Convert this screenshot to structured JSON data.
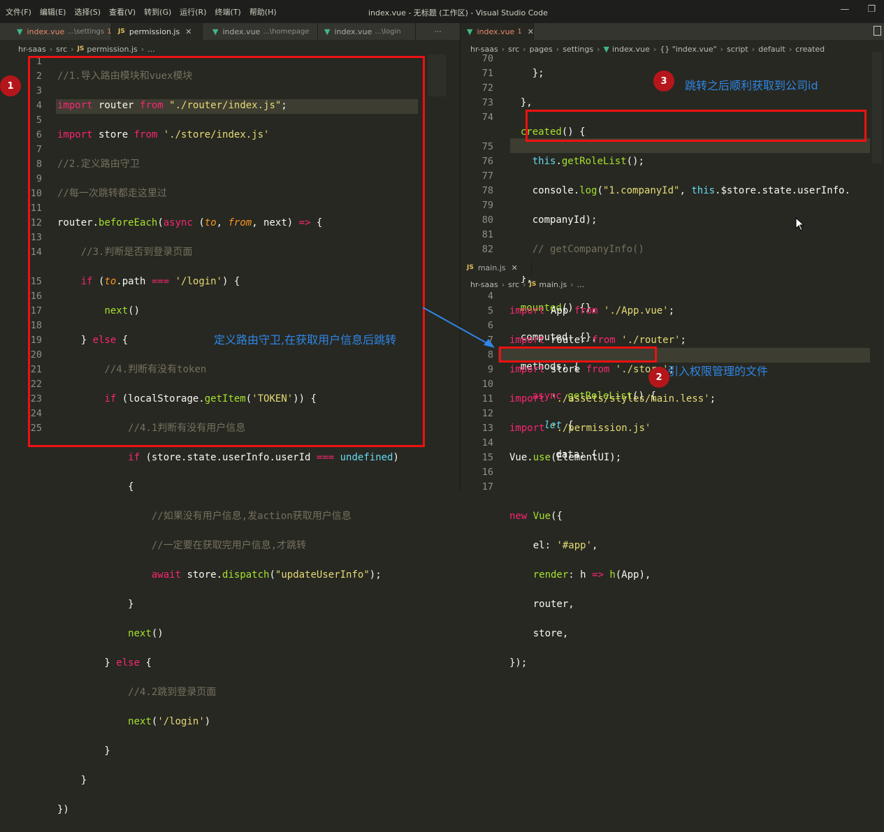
{
  "menu": [
    "文件(F)",
    "编辑(E)",
    "选择(S)",
    "查看(V)",
    "转到(G)",
    "运行(R)",
    "终端(T)",
    "帮助(H)"
  ],
  "window_title": "index.vue - 无标题 (工作区) - Visual Studio Code",
  "window_controls": [
    "—",
    "❐"
  ],
  "left_tabs": [
    {
      "name": "index.vue",
      "desc": "...\\settings",
      "badge": "1"
    },
    {
      "name": "permission.js"
    },
    {
      "name": "index.vue",
      "desc": "...\\homepage"
    },
    {
      "name": "index.vue",
      "desc": "...\\login"
    }
  ],
  "more_icon": "···",
  "right_tab": {
    "name": "index.vue",
    "badge": "1"
  },
  "main_tab": {
    "name": "main.js"
  },
  "left_crumb": [
    "hr-saas",
    "src",
    "permission.js",
    "..."
  ],
  "right_crumb": [
    "hr-saas",
    "src",
    "pages",
    "settings",
    "index.vue",
    "{} \"index.vue\"",
    "script",
    "default",
    "created"
  ],
  "bottom_crumb": [
    "hr-saas",
    "src",
    "main.js",
    "..."
  ],
  "left_lines": [
    "1",
    "2",
    "3",
    "4",
    "5",
    "6",
    "7",
    "8",
    "9",
    "10",
    "11",
    "12",
    "13",
    "14",
    "",
    "15",
    "16",
    "17",
    "18",
    "19",
    "20",
    "21",
    "22",
    "23",
    "24",
    "25"
  ],
  "right_lines": [
    "70",
    "71",
    "72",
    "73",
    "74",
    "",
    "75",
    "76",
    "77",
    "78",
    "79",
    "80",
    "81",
    "82"
  ],
  "bottom_lines": [
    "4",
    "5",
    "6",
    "7",
    "8",
    "9",
    "10",
    "11",
    "12",
    "13",
    "14",
    "15",
    "16",
    "17"
  ],
  "annotations": {
    "badge1": "1",
    "badge2": "2",
    "badge3": "3",
    "note_left": "定义路由守卫,在获取用户信息后跳转",
    "note_top": "跳转之后顺利获取到公司id",
    "note_bottom": "引入权限管理的文件"
  },
  "colors": {
    "accent_box": "#e11111",
    "note": "#2f86e6",
    "badge": "#b5161b"
  }
}
